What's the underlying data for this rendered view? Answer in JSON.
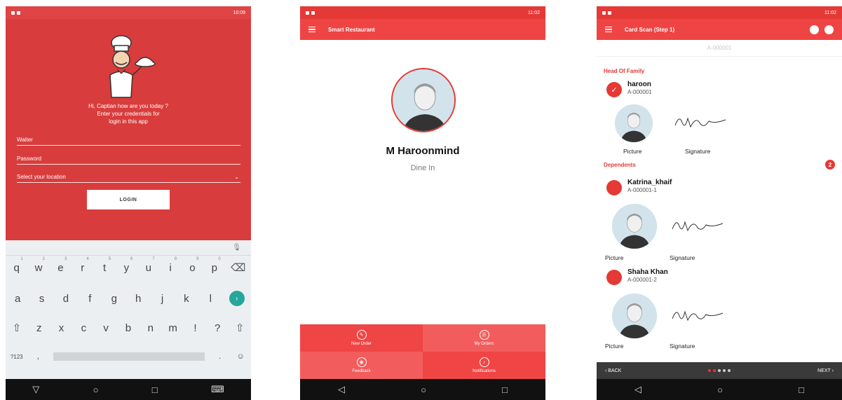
{
  "login": {
    "status_time": "10:09",
    "greeting_line1": "Hi, Captian how are you today ?",
    "greeting_line2": "Enter your credentials for",
    "greeting_line3": "login in this app",
    "waiter_placeholder": "Waiter",
    "password_placeholder": "Password",
    "location_placeholder": "Select your location",
    "login_button": "LOGIN",
    "keyboard": {
      "row1": [
        "q",
        "w",
        "e",
        "r",
        "t",
        "y",
        "u",
        "i",
        "o",
        "p"
      ],
      "row1_hints": [
        "1",
        "2",
        "3",
        "4",
        "5",
        "6",
        "7",
        "8",
        "9",
        "0"
      ],
      "row2": [
        "a",
        "s",
        "d",
        "f",
        "g",
        "h",
        "j",
        "k",
        "l"
      ],
      "row3": [
        "z",
        "x",
        "c",
        "v",
        "b",
        "n",
        "m",
        "!",
        "?"
      ],
      "numbers_key": "?123",
      "comma": ",",
      "period": "."
    }
  },
  "home": {
    "status_time": "11:02",
    "app_title": "Smart Restaurant",
    "user_name": "M Haroonmind",
    "user_mode": "Dine In",
    "menu": [
      {
        "label": "New Order",
        "icon": "pencil-icon"
      },
      {
        "label": "My Orders",
        "icon": "orders-icon"
      },
      {
        "label": "Feedback",
        "icon": "feedback-icon"
      },
      {
        "label": "Notifications",
        "icon": "bell-icon"
      }
    ],
    "colors": {
      "primary": "#ef4444",
      "tile_dark": "#f04545",
      "tile_light": "#f25c5c"
    }
  },
  "cardscan": {
    "status_time": "11:02",
    "title": "Card Scan (Step 1)",
    "card_number": "A-000001",
    "head_section": "Head Of Family",
    "dependents_section": "Dependents",
    "dependents_count": "2",
    "picture_label": "Picture",
    "signature_label": "Signature",
    "head": {
      "name": "haroon",
      "id": "A-000001"
    },
    "dependents": [
      {
        "name": "Katrina_khaif",
        "id": "A-000001-1"
      },
      {
        "name": "Shaha Khan",
        "id": "A-000001-2"
      }
    ],
    "back_label": "‹ BACK",
    "next_label": "NEXT ›"
  }
}
